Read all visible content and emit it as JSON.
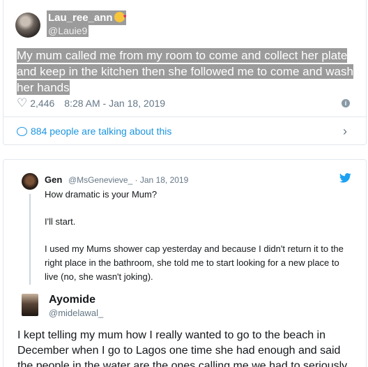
{
  "tweet": {
    "display_name": "Lau_ree_ann",
    "handle": "@Lauie9",
    "text": "My mum called me from my room to come and collect her plate and keep in the kitchen then she followed me to come and wash her hands",
    "likes": "2,446",
    "timestamp": "8:28 AM - Jan 18, 2019",
    "talking": "884 people are talking about this"
  },
  "quoted": {
    "name": "Gen",
    "handle_date": "@MsGenevieve_ · Jan 18, 2019",
    "paragraphs": [
      "How dramatic is your Mum?",
      "I'll start.",
      "I used my Mums shower cap yesterday and because I didn't return it to the right place in the bathroom, she told me to start looking for a new place to live (no, she wasn't joking)."
    ]
  },
  "reply": {
    "name": "Ayomide",
    "handle": "@midelawal_",
    "text": "I kept telling my mum how I really wanted to go to the beach in December when I go to Lagos one time she had enough and said the people in the water are the ones calling me we had to seriously"
  },
  "colors": {
    "link_blue": "#1b95e0",
    "highlight_grey": "#9b9b9b",
    "muted": "#657786"
  },
  "icons": [
    "heart-icon",
    "info-icon",
    "comment-bubble-icon",
    "chevron-right-icon",
    "twitter-bird-icon"
  ]
}
